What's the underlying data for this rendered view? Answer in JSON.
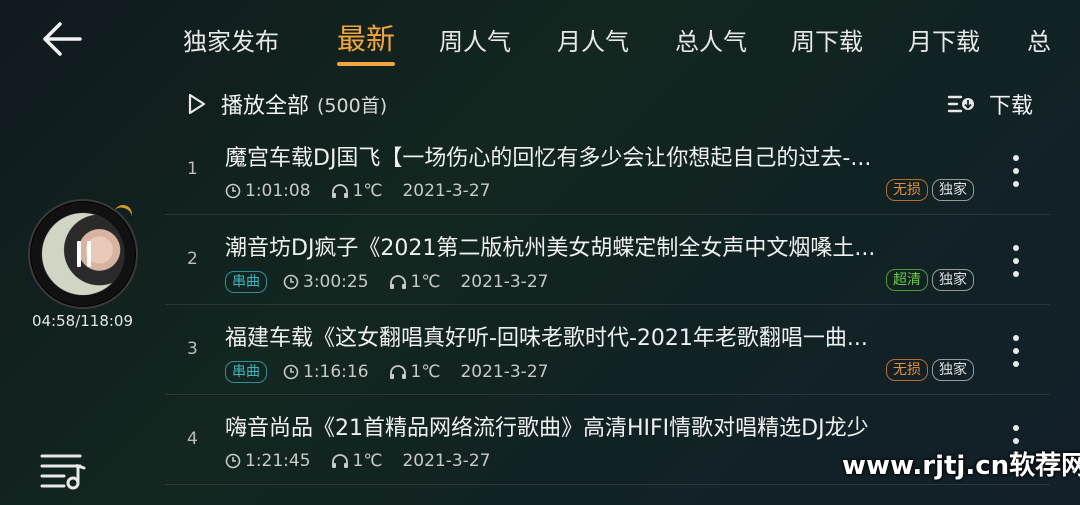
{
  "tabs": [
    {
      "label": "独家发布"
    },
    {
      "label": "最新"
    },
    {
      "label": "周人气"
    },
    {
      "label": "月人气"
    },
    {
      "label": "总人气"
    },
    {
      "label": "周下载"
    },
    {
      "label": "月下载"
    },
    {
      "label": "总"
    }
  ],
  "active_tab": "最新",
  "toolbar": {
    "play_all_label": "播放全部",
    "count": "(500首)",
    "download_label": "下载"
  },
  "player": {
    "time": "04:58/118:09"
  },
  "songs": [
    {
      "num": "1",
      "title": "魔宫车载DJ国飞【一场伤心的回忆有多少会让你想起自己的过去-...",
      "serial": "",
      "duration": "1:01:08",
      "plays": "1℃",
      "date": "2021-3-27",
      "quality": "无损",
      "tag": "独家"
    },
    {
      "num": "2",
      "title": "潮音坊DJ疯子《2021第二版杭州美女胡蝶定制全女声中文烟嗓土...",
      "serial": "串曲",
      "duration": "3:00:25",
      "plays": "1℃",
      "date": "2021-3-27",
      "quality": "超清",
      "tag": "独家"
    },
    {
      "num": "3",
      "title": "福建车载《这女翻唱真好听-回味老歌时代-2021年老歌翻唱一曲...",
      "serial": "串曲",
      "duration": "1:16:16",
      "plays": "1℃",
      "date": "2021-3-27",
      "quality": "无损",
      "tag": "独家"
    },
    {
      "num": "4",
      "title": "嗨音尚品《21首精品网络流行歌曲》高清HIFI情歌对唱精选DJ龙少",
      "serial": "",
      "duration": "1:21:45",
      "plays": "1℃",
      "date": "2021-3-27",
      "quality": "",
      "tag": ""
    }
  ],
  "watermark": "www.rjtj.cn软荐网",
  "colors": {
    "accent": "#f3a43a",
    "serial": "#3bb7c4",
    "lossless": "#e48f3a",
    "hd": "#6ccf3f"
  }
}
